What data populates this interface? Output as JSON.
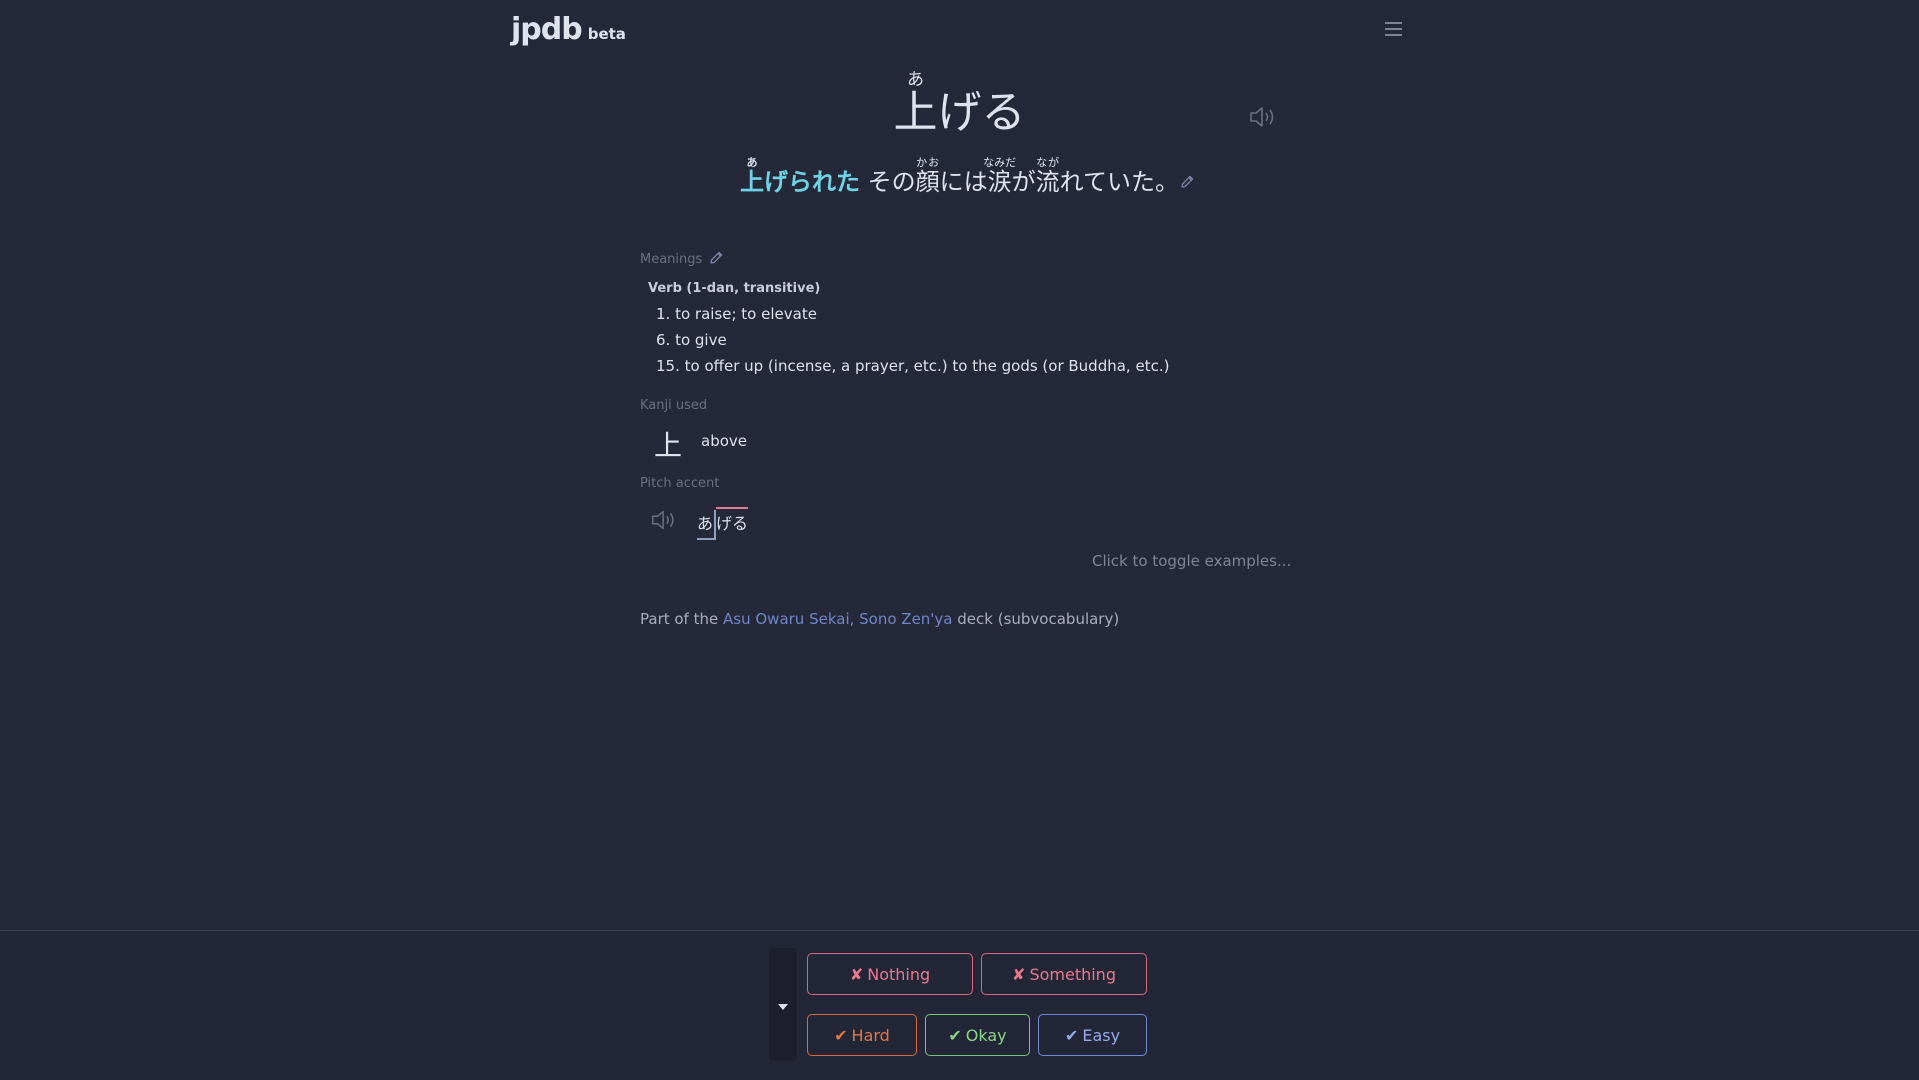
{
  "header": {
    "logo": "jpdb",
    "logo_suffix": "beta",
    "menu_icon": "hamburger-menu-icon"
  },
  "vocab": {
    "kanji": "上",
    "reading": "あ",
    "okurigana": "げる"
  },
  "sentence": {
    "highlight_kanji": "上",
    "highlight_reading": "あ",
    "highlight_rest": "げられた",
    "part1": "その",
    "kanji2": "顔",
    "reading2": "かお",
    "part2": "には",
    "kanji3": "涙",
    "reading3": "なみだ",
    "part3": "が",
    "kanji4": "流",
    "reading4": "なが",
    "part4": "れていた。"
  },
  "meanings": {
    "label": "Meanings",
    "part_of_speech": "Verb (1-dan, transitive)",
    "items": [
      "1. to raise; to elevate",
      "6. to give",
      "15. to offer up (incense, a prayer, etc.) to the gods (or Buddha, etc.)"
    ]
  },
  "kanji_used": {
    "label": "Kanji used",
    "kanji": "上",
    "meaning": "above"
  },
  "pitch_accent": {
    "label": "Pitch accent",
    "low": "あ",
    "high": "げる"
  },
  "toggle_examples": "Click to toggle examples...",
  "deck": {
    "prefix": "Part of the",
    "name": "Asu Owaru Sekai, Sono Zen'ya",
    "suffix": "deck (subvocabulary)"
  },
  "review_buttons": {
    "nothing": "Nothing",
    "something": "Something",
    "hard": "Hard",
    "okay": "Okay",
    "easy": "Easy",
    "fail_mark": "✘",
    "pass_mark": "✔"
  },
  "colors": {
    "background": "#252838",
    "highlight": "#6fd3e6",
    "fail": "#e8798f",
    "hard": "#e2773f",
    "okay": "#8ad48a",
    "easy": "#93aae8",
    "link": "#6f86c9"
  }
}
